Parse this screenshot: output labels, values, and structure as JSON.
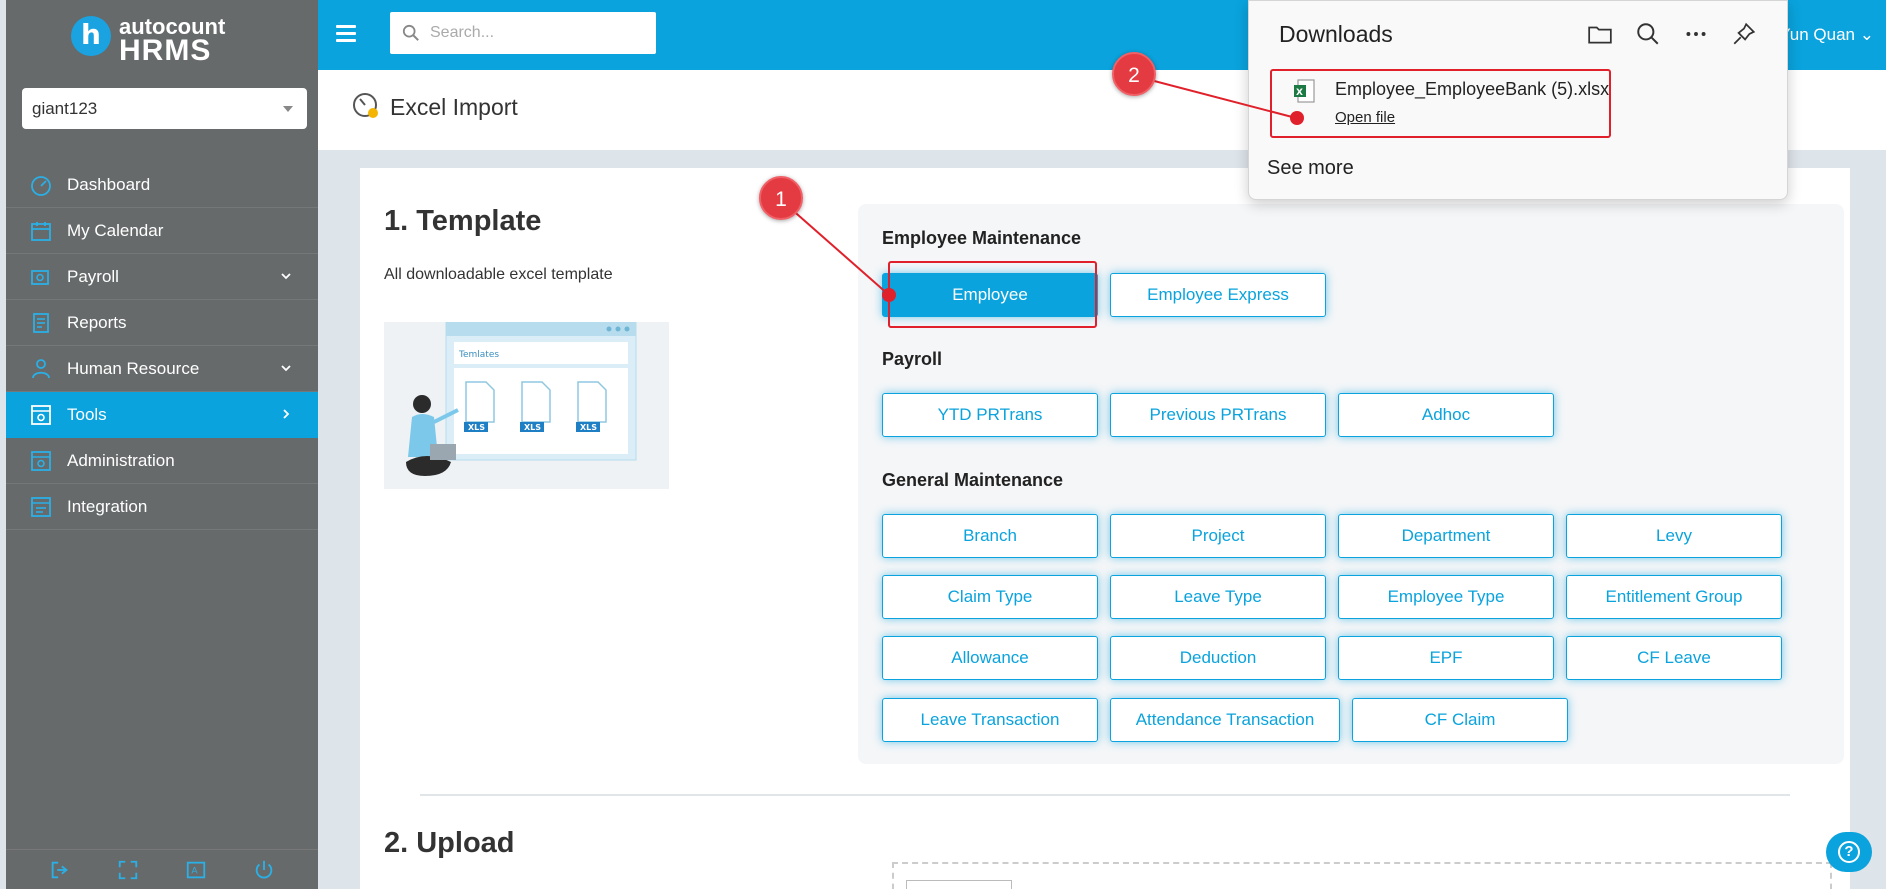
{
  "brand": {
    "top": "autocount",
    "bottom": "HRMS"
  },
  "company_select": {
    "value": "giant123"
  },
  "sidebar": {
    "items": [
      {
        "label": "Dashboard",
        "icon": "dashboard-icon"
      },
      {
        "label": "My Calendar",
        "icon": "calendar-icon"
      },
      {
        "label": "Payroll",
        "icon": "payroll-icon",
        "expand": "down"
      },
      {
        "label": "Reports",
        "icon": "reports-icon"
      },
      {
        "label": "Human Resource",
        "icon": "human-resource-icon",
        "expand": "down"
      },
      {
        "label": "Tools",
        "icon": "tools-icon",
        "expand": "right",
        "active": true
      },
      {
        "label": "Administration",
        "icon": "administration-icon"
      },
      {
        "label": "Integration",
        "icon": "integration-icon"
      }
    ],
    "bottom_icons": [
      "logout-icon",
      "fullscreen-icon",
      "language-icon",
      "power-icon"
    ]
  },
  "topbar": {
    "search_placeholder": "Search...",
    "user": "Yun Quan"
  },
  "page": {
    "title": "Excel Import"
  },
  "template": {
    "title": "1. Template",
    "desc": "All downloadable excel template",
    "illustration": {
      "header": "Temlates",
      "badge": "XLS"
    },
    "groups": {
      "employee": {
        "title": "Employee Maintenance",
        "buttons": [
          "Employee",
          "Employee Express"
        ]
      },
      "payroll": {
        "title": "Payroll",
        "buttons": [
          "YTD PRTrans",
          "Previous PRTrans",
          "Adhoc"
        ]
      },
      "general": {
        "title": "General Maintenance",
        "buttons": [
          "Branch",
          "Project",
          "Department",
          "Levy",
          "Claim Type",
          "Leave Type",
          "Employee Type",
          "Entitlement Group",
          "Allowance",
          "Deduction",
          "EPF",
          "CF Leave",
          "Leave Transaction",
          "Attendance Transaction",
          "CF Claim"
        ]
      }
    }
  },
  "upload": {
    "title": "2. Upload"
  },
  "downloads": {
    "title": "Downloads",
    "file_name": "Employee_EmployeeBank (5).xlsx",
    "open_label": "Open file",
    "see_more": "See more"
  },
  "annotations": {
    "step1": "1",
    "step2": "2"
  },
  "colors": {
    "accent": "#0aa3dd",
    "sidebar": "#666a6b",
    "annotation": "#e0202a"
  }
}
